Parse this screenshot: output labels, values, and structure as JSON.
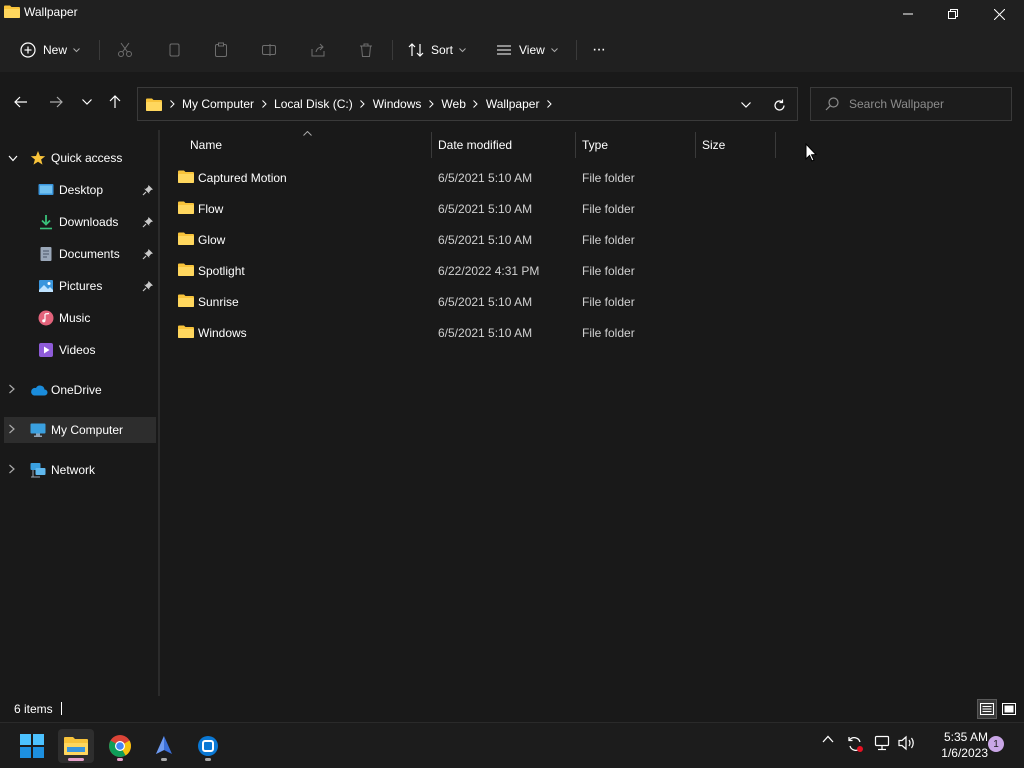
{
  "window": {
    "title": "Wallpaper"
  },
  "toolbar": {
    "new_label": "New",
    "sort_label": "Sort",
    "view_label": "View",
    "more_label": "···"
  },
  "address": {
    "crumbs": [
      "My Computer",
      "Local Disk (C:)",
      "Windows",
      "Web",
      "Wallpaper"
    ]
  },
  "search": {
    "placeholder": "Search Wallpaper"
  },
  "sidebar": {
    "quick_access": "Quick access",
    "items": [
      {
        "label": "Desktop",
        "icon": "desktop-icon",
        "pinned": true
      },
      {
        "label": "Downloads",
        "icon": "downloads-icon",
        "pinned": true
      },
      {
        "label": "Documents",
        "icon": "documents-icon",
        "pinned": true
      },
      {
        "label": "Pictures",
        "icon": "pictures-icon",
        "pinned": true
      },
      {
        "label": "Music",
        "icon": "music-icon",
        "pinned": false
      },
      {
        "label": "Videos",
        "icon": "videos-icon",
        "pinned": false
      }
    ],
    "onedrive": "OneDrive",
    "my_computer": "My Computer",
    "network": "Network"
  },
  "columns": {
    "name": "Name",
    "date": "Date modified",
    "type": "Type",
    "size": "Size"
  },
  "files": [
    {
      "name": "Captured Motion",
      "date": "6/5/2021 5:10 AM",
      "type": "File folder"
    },
    {
      "name": "Flow",
      "date": "6/5/2021 5:10 AM",
      "type": "File folder"
    },
    {
      "name": "Glow",
      "date": "6/5/2021 5:10 AM",
      "type": "File folder"
    },
    {
      "name": "Spotlight",
      "date": "6/22/2022 4:31 PM",
      "type": "File folder"
    },
    {
      "name": "Sunrise",
      "date": "6/5/2021 5:10 AM",
      "type": "File folder"
    },
    {
      "name": "Windows",
      "date": "6/5/2021 5:10 AM",
      "type": "File folder"
    }
  ],
  "status": {
    "item_count": "6 items"
  },
  "taskbar": {
    "time": "5:35 AM",
    "date": "1/6/2023",
    "notification_count": "1"
  },
  "colors": {
    "folder": "#f8c33a",
    "accent": "#4cc2ff",
    "selected": "#2d2d2d",
    "background": "#191919"
  }
}
